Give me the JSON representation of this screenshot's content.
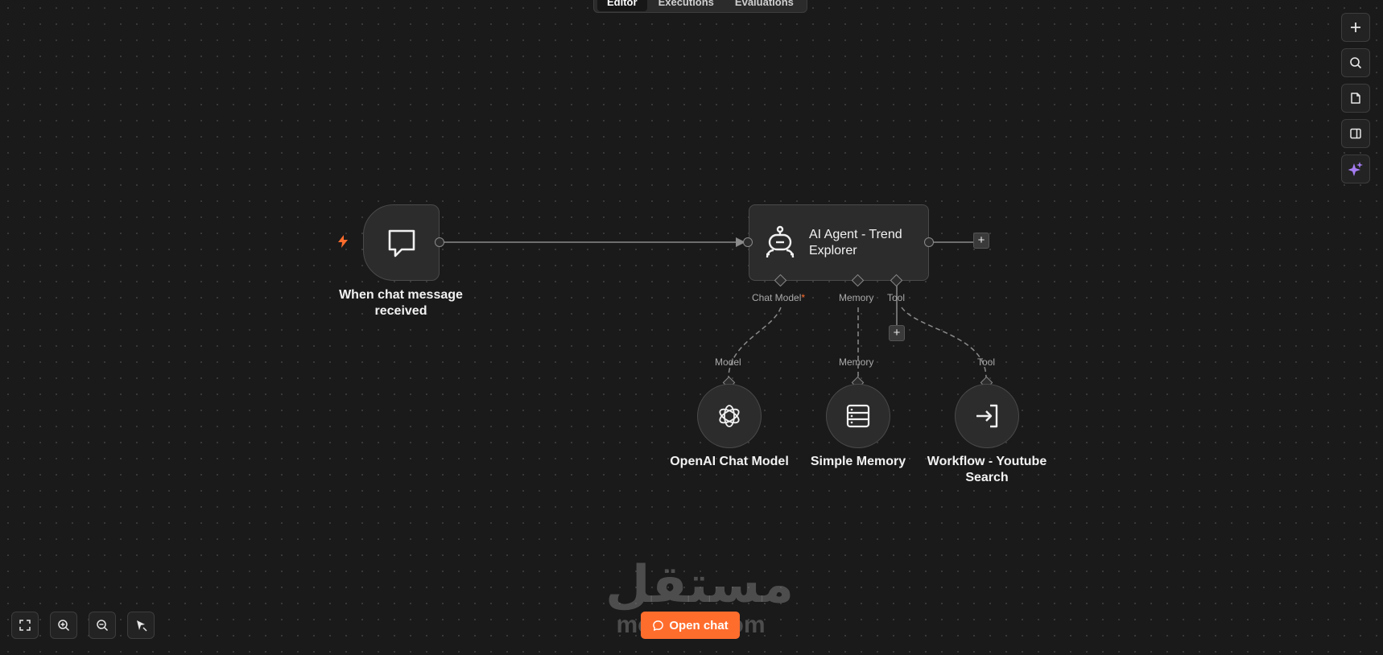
{
  "header": {
    "tabs": [
      {
        "label": "Editor",
        "active": true
      },
      {
        "label": "Executions",
        "active": false
      },
      {
        "label": "Evaluations",
        "active": false
      }
    ]
  },
  "right_toolbar": [
    {
      "icon": "plus-icon"
    },
    {
      "icon": "search-icon"
    },
    {
      "icon": "sticky-note-icon"
    },
    {
      "icon": "side-panel-icon"
    },
    {
      "icon": "ai-sparkle-icon"
    }
  ],
  "bottom_toolbar": [
    {
      "icon": "fit-view-icon"
    },
    {
      "icon": "zoom-in-icon"
    },
    {
      "icon": "zoom-out-icon"
    },
    {
      "icon": "tidy-up-icon"
    }
  ],
  "nodes": {
    "trigger": {
      "label": "When chat message received",
      "icon": "chat-bubble-icon"
    },
    "agent": {
      "label": "AI Agent - Trend Explorer",
      "icon": "robot-icon"
    },
    "openai": {
      "label": "OpenAI Chat Model",
      "icon": "openai-icon"
    },
    "memory": {
      "label": "Simple Memory",
      "icon": "database-icon"
    },
    "workflow": {
      "label": "Workflow - Youtube Search",
      "icon": "sign-in-arrow-icon"
    }
  },
  "ports": {
    "chat_model": "Chat Model",
    "chat_model_required": "*",
    "memory": "Memory",
    "tool": "Tool",
    "model_in": "Model",
    "memory_in": "Memory",
    "tool_in": "Tool"
  },
  "open_chat_label": "Open chat",
  "watermark": {
    "arabic": "مستقل",
    "latin": "mostaql.com"
  },
  "colors": {
    "accent": "#ff6d2d",
    "ai_purple": "#a57cf0",
    "canvas": "#1a1a1a"
  }
}
